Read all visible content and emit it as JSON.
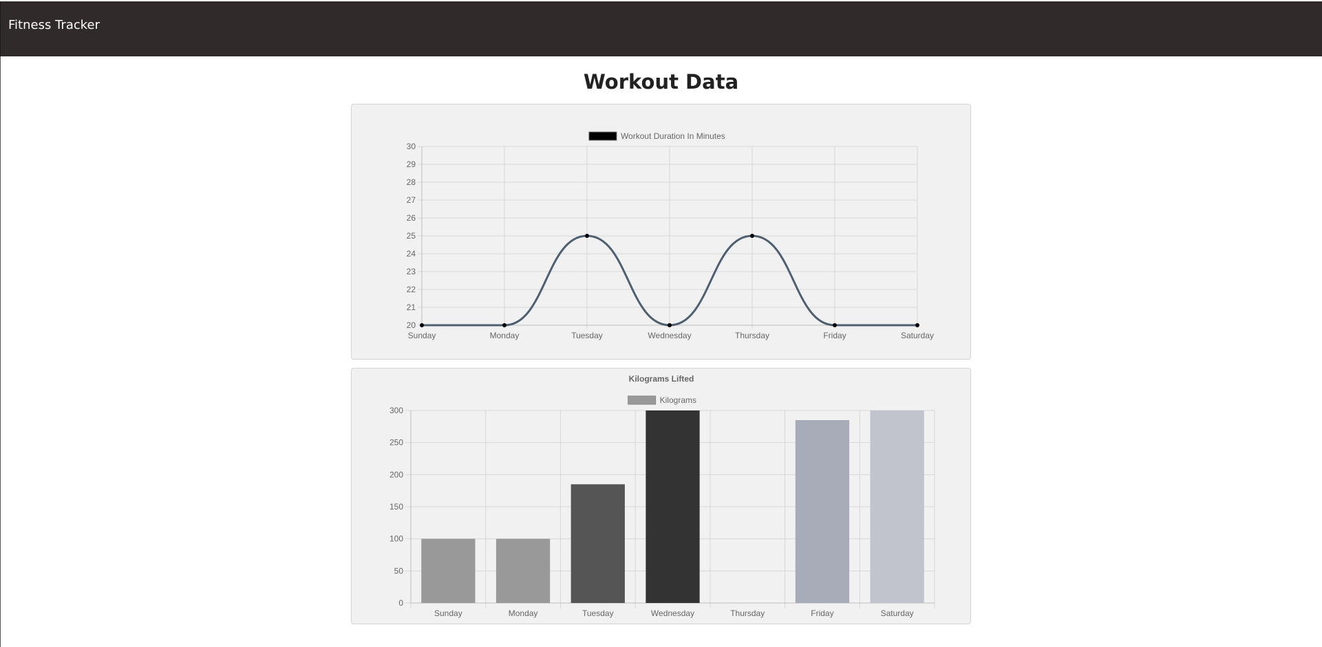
{
  "app": {
    "title": "Fitness Tracker"
  },
  "page": {
    "title": "Workout Data"
  },
  "chart_data": [
    {
      "type": "line",
      "title": "",
      "categories": [
        "Sunday",
        "Monday",
        "Tuesday",
        "Wednesday",
        "Thursday",
        "Friday",
        "Saturday"
      ],
      "series": [
        {
          "name": "Workout Duration In Minutes",
          "values": [
            20,
            20,
            25,
            20,
            25,
            20,
            20
          ]
        }
      ],
      "ylim": [
        20,
        30
      ],
      "yticks": [
        20,
        21,
        22,
        23,
        24,
        25,
        26,
        27,
        28,
        29,
        30
      ],
      "grid": true,
      "legend": "top",
      "colors": {
        "line": "#4e6070",
        "legend_box": "#000000",
        "point": "#000000"
      }
    },
    {
      "type": "bar",
      "title": "Kilograms Lifted",
      "categories": [
        "Sunday",
        "Monday",
        "Tuesday",
        "Wednesday",
        "Thursday",
        "Friday",
        "Saturday"
      ],
      "series": [
        {
          "name": "Kilograms",
          "values": [
            100,
            100,
            185,
            300,
            0,
            285,
            300
          ]
        }
      ],
      "ylim": [
        0,
        300
      ],
      "yticks": [
        0,
        50,
        100,
        150,
        200,
        250,
        300
      ],
      "grid": true,
      "legend": "top",
      "colors": {
        "legend_box": "#999999",
        "bars": [
          "#999999",
          "#999999",
          "#555555",
          "#333333",
          "#dddddd",
          "#a8acb9",
          "#c1c4cc"
        ]
      }
    }
  ]
}
